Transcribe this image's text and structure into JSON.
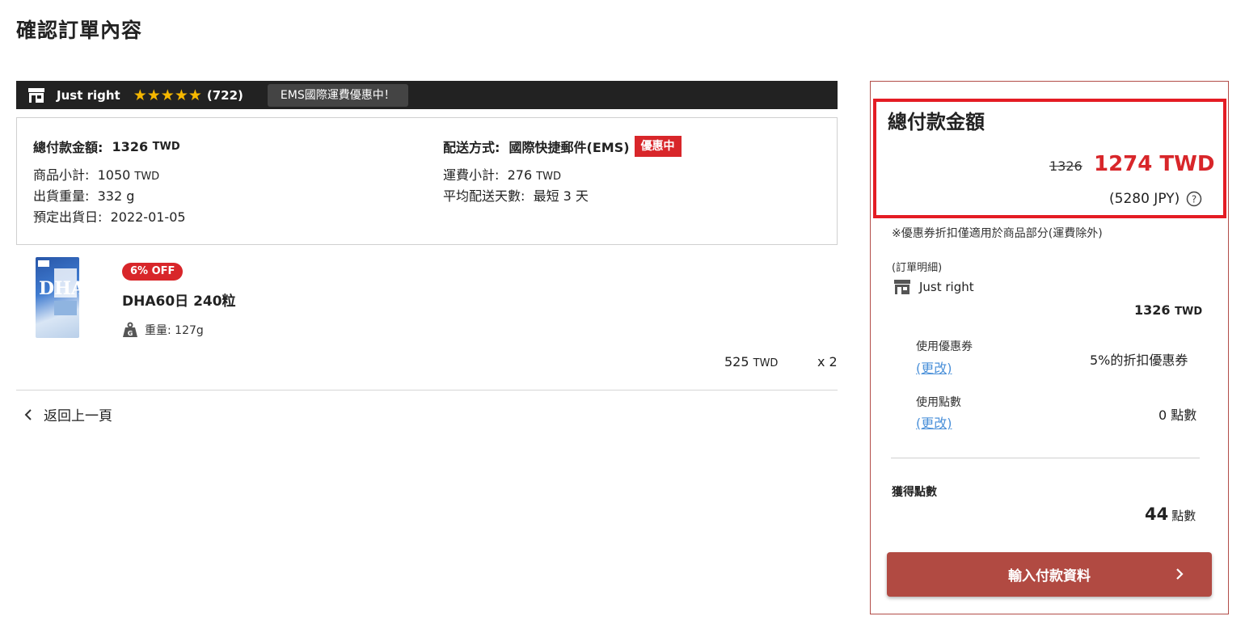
{
  "page": {
    "title": "確認訂單內容"
  },
  "shop": {
    "name": "Just right",
    "stars": "★★★★★",
    "review_count": "(722)",
    "ems_badge": "EMS國際運費優惠中！"
  },
  "summary": {
    "total_label": "總付款金額:",
    "total_value": "1326",
    "currency": "TWD",
    "subtotal_label": "商品小計:",
    "subtotal_value": "1050",
    "weight_label": "出貨重量:",
    "weight_value": "332 g",
    "ship_date_label": "預定出貨日:",
    "ship_date_value": "2022-01-05",
    "shipping_method_label": "配送方式:",
    "shipping_method_value": "國際快捷郵件(EMS)",
    "promo_tag": "優惠中",
    "shipping_fee_label": "運費小計:",
    "shipping_fee_value": "276",
    "avg_days_label": "平均配送天數:",
    "avg_days_value": "最短 3 天"
  },
  "product": {
    "discount_badge": "6% OFF",
    "name": "DHA60日 240粒",
    "weight_text": "重量: 127g",
    "unit_price": "525",
    "currency": "TWD",
    "quantity": "x 2",
    "image_text": "DHA"
  },
  "nav": {
    "back_label": "返回上一頁"
  },
  "panel": {
    "total_title": "總付款金額",
    "original_price": "1326",
    "final_price": "1274 TWD",
    "jpy": "(5280 JPY)",
    "coupon_note": "※優惠券折扣僅適用於商品部分(運費除外)",
    "detail_label": "(訂單明細)",
    "shop_name": "Just right",
    "shop_subtotal": "1326",
    "currency": "TWD",
    "coupon_label": "使用優惠券",
    "coupon_change": "(更改)",
    "coupon_value": "5%的折扣優惠券",
    "points_label": "使用點數",
    "points_change": "(更改)",
    "points_value": "0 點數",
    "earn_label": "獲得點數",
    "earn_value": "44",
    "earn_unit": "點數",
    "pay_button": "輸入付款資料"
  },
  "colors": {
    "accent_red": "#d8262a",
    "button_brown": "#b14a42",
    "link_blue": "#4a90d9",
    "highlight_border": "#e41c24"
  },
  "icons": {
    "store": "store-icon",
    "star": "star-icon",
    "weight": "weight-icon",
    "back": "chevron-left-icon",
    "help": "help-circle-icon",
    "arrow": "chevron-right-icon"
  }
}
